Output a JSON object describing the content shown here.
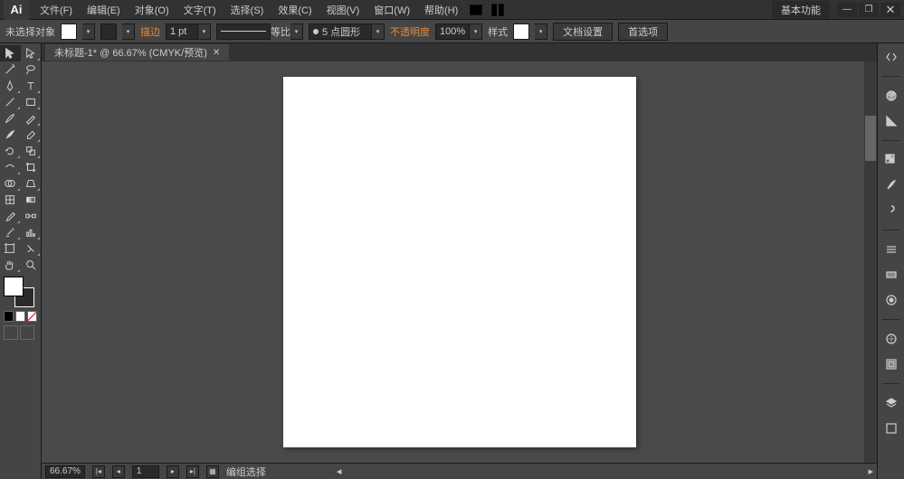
{
  "app": {
    "logo": "Ai"
  },
  "menu": {
    "file": "文件(F)",
    "edit": "编辑(E)",
    "object": "对象(O)",
    "type": "文字(T)",
    "select": "选择(S)",
    "effect": "效果(C)",
    "view": "视图(V)",
    "window": "窗口(W)",
    "help": "帮助(H)"
  },
  "workspace": "基本功能",
  "optbar": {
    "no_selection": "未选择对象",
    "stroke_label": "描边",
    "stroke_width": "1 pt",
    "uniform": "等比",
    "brush": "5 点圆形",
    "opacity_label": "不透明度",
    "opacity_value": "100%",
    "style_label": "样式",
    "doc_setup": "文档设置",
    "prefs": "首选项"
  },
  "doc": {
    "tab_title": "未标题-1* @ 66.67% (CMYK/预览)"
  },
  "status": {
    "zoom": "66.67%",
    "page": "1",
    "selection": "编组选择"
  }
}
